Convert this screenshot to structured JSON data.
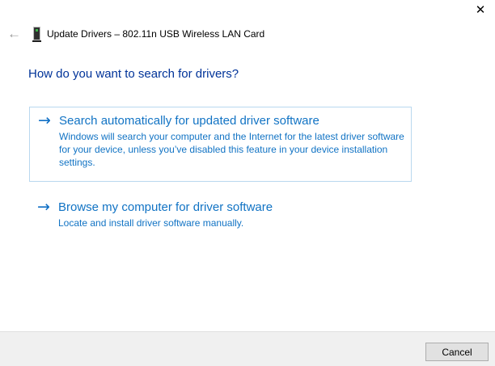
{
  "window": {
    "title": "Update Drivers – 802.11n USB Wireless LAN Card"
  },
  "header": {
    "back_icon": "←",
    "close_icon": "✕",
    "device_icon": "driver-device-icon"
  },
  "heading": "How do you want to search for drivers?",
  "options": [
    {
      "arrow_icon": "→",
      "title": "Search automatically for updated driver software",
      "description": "Windows will search your computer and the Internet for the latest driver software for your device, unless you’ve disabled this feature in your device installation settings."
    },
    {
      "arrow_icon": "→",
      "title": "Browse my computer for driver software",
      "description": "Locate and install driver software manually."
    }
  ],
  "footer": {
    "cancel_label": "Cancel"
  },
  "colors": {
    "heading_blue": "#003399",
    "link_blue": "#1173c4",
    "option_border": "#b9d8ef",
    "footer_bg": "#f0f0f0",
    "footer_divider": "#dfdfdf",
    "button_bg": "#e1e1e1",
    "button_border": "#adadad",
    "led_green": "#3db449"
  }
}
